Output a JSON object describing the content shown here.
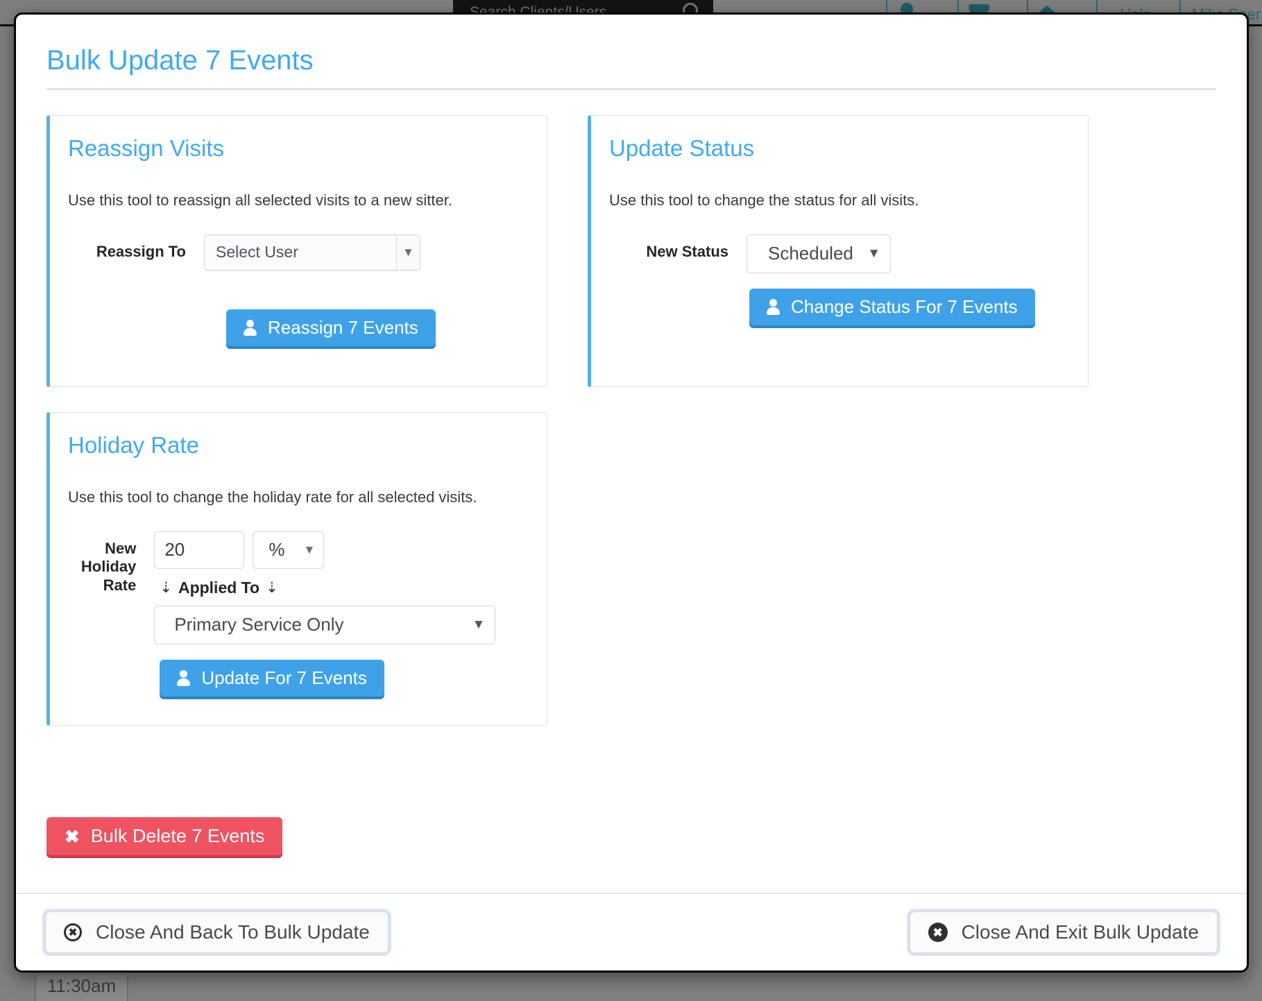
{
  "background": {
    "search_placeholder": "Search Clients/Users",
    "search_icon": "search-icon",
    "nav_items": [
      {
        "label": "",
        "icon": "user-icon"
      },
      {
        "label": "",
        "icon": "chat-icon"
      },
      {
        "label": "",
        "icon": "home-icon"
      },
      {
        "label": "Help",
        "icon": ""
      },
      {
        "label": "Mike Sper",
        "icon": ""
      }
    ],
    "calendar_time": "11:30am"
  },
  "modal": {
    "title": "Bulk Update 7 Events",
    "panels": {
      "reassign": {
        "title": "Reassign Visits",
        "description": "Use this tool to reassign all selected visits to a new sitter.",
        "field_label": "Reassign To",
        "select_value": "Select User",
        "caret": "▼",
        "button_label": "Reassign 7 Events",
        "button_icon": "user-icon"
      },
      "status": {
        "title": "Update Status",
        "description": "Use this tool to change the status for all visits.",
        "field_label": "New Status",
        "select_value": "Scheduled",
        "caret": "▼",
        "button_label": "Change Status For 7 Events",
        "button_icon": "user-icon"
      },
      "holiday": {
        "title": "Holiday Rate",
        "description": "Use this tool to change the holiday rate for all selected visits.",
        "field_label": "New Holiday Rate",
        "rate_value": "20",
        "unit_value": "%",
        "unit_caret": "▼",
        "applied_to_label": "Applied To",
        "applied_to_arrow": "⇣",
        "applied_to_value": "Primary Service Only",
        "applied_caret": "▼",
        "button_label": "Update For 7 Events",
        "button_icon": "user-icon"
      }
    },
    "bulk_delete": {
      "label": "Bulk Delete 7 Events",
      "icon": "x-icon"
    },
    "footer": {
      "back_label": "Close And Back To Bulk Update",
      "back_icon": "circle-x-outline-icon",
      "exit_label": "Close And Exit Bulk Update",
      "exit_icon": "circle-x-solid-icon",
      "x_glyph": "✖"
    }
  },
  "colors": {
    "accent_blue": "#3fa9f5",
    "button_blue": "#3fa2e8",
    "danger_red": "#ef5261",
    "panel_border_blue": "#57b0e8"
  }
}
